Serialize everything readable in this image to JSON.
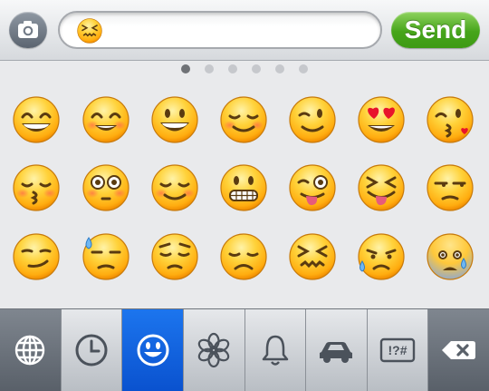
{
  "compose": {
    "camera_icon": "camera-icon",
    "field_emoji": "confounded-face",
    "send_label": "Send"
  },
  "pager": {
    "pages": 6,
    "active_page": 1
  },
  "emoji_rows": [
    [
      "grinning-face-with-smiling-eyes",
      "smiling-face-with-smiling-eyes",
      "smiling-face-with-open-mouth",
      "relieved-face",
      "winking-face",
      "heart-eyes-face",
      "face-throwing-kiss"
    ],
    [
      "kissing-face-with-closed-eyes",
      "flushed-face",
      "relieved-face",
      "grimacing-face",
      "face-with-tongue-winking",
      "face-with-tongue-closed-eyes",
      "unamused-face"
    ],
    [
      "smirking-face",
      "face-with-cold-sweat",
      "pensive-face",
      "disappointed-face",
      "confounded-face",
      "disappointed-relieved-face",
      "fearful-face-with-sweat"
    ]
  ],
  "categories": [
    {
      "name": "globe-icon",
      "state": "dark"
    },
    {
      "name": "recent-clock-icon",
      "state": "normal"
    },
    {
      "name": "smiley-icon",
      "state": "active"
    },
    {
      "name": "flower-icon",
      "state": "normal"
    },
    {
      "name": "bell-icon",
      "state": "normal"
    },
    {
      "name": "car-icon",
      "state": "normal"
    },
    {
      "name": "symbols-icon",
      "state": "normal",
      "label": "!?#"
    },
    {
      "name": "delete-icon",
      "state": "dark"
    }
  ],
  "colors": {
    "accent_blue": "#0a52cf",
    "send_green": "#46a51a",
    "emoji_yellow": "#ffc21c"
  }
}
